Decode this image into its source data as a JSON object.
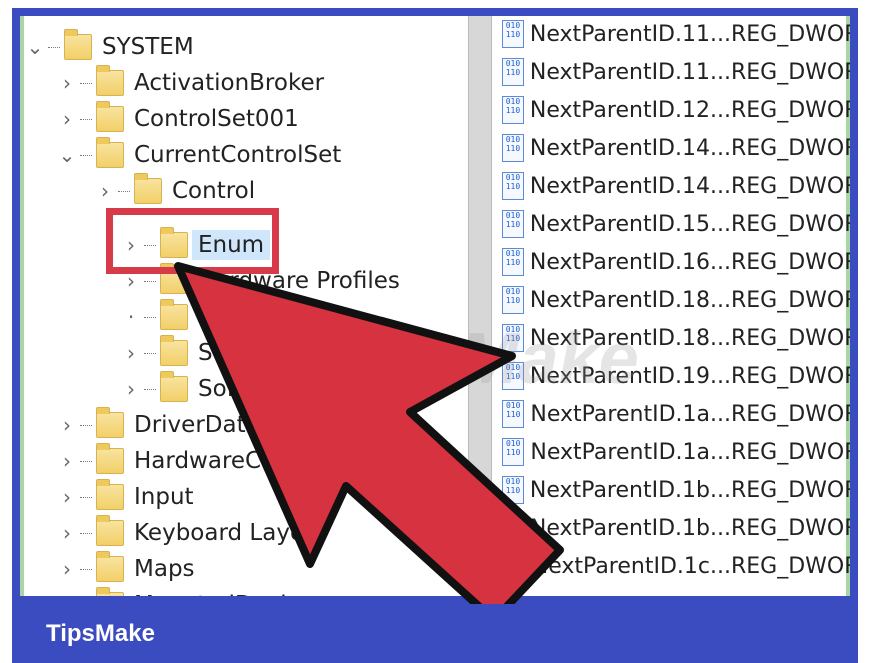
{
  "tree": {
    "items": [
      {
        "label": "SYSTEM",
        "expanded": true
      },
      {
        "label": "ActivationBroker",
        "expanded": false
      },
      {
        "label": "ControlSet001",
        "expanded": false
      },
      {
        "label": "CurrentControlSet",
        "expanded": true
      },
      {
        "label": "Control",
        "expanded": false
      },
      {
        "label": "Enum",
        "expanded": false,
        "selected": true
      },
      {
        "label": "Hardware Profiles",
        "expanded": false
      },
      {
        "label": "P",
        "expanded": false
      },
      {
        "label": "Ser",
        "expanded": false
      },
      {
        "label": "Softv",
        "expanded": false
      },
      {
        "label": "DriverData",
        "expanded": false
      },
      {
        "label": "HardwareCo",
        "expanded": false
      },
      {
        "label": "Input",
        "expanded": false
      },
      {
        "label": "Keyboard Layo",
        "expanded": false
      },
      {
        "label": "Maps",
        "expanded": false
      },
      {
        "label": "MountedDevices",
        "expanded": false
      }
    ]
  },
  "values": {
    "rows": [
      {
        "name": "NextParentID.11...",
        "type": "REG_DWORI"
      },
      {
        "name": "NextParentID.11...",
        "type": "REG_DWORI"
      },
      {
        "name": "NextParentID.12...",
        "type": "REG_DWORI"
      },
      {
        "name": "NextParentID.14...",
        "type": "REG_DWORI"
      },
      {
        "name": "NextParentID.14...",
        "type": "REG_DWORI"
      },
      {
        "name": "NextParentID.15...",
        "type": "REG_DWORI"
      },
      {
        "name": "NextParentID.16...",
        "type": "REG_DWORI"
      },
      {
        "name": "NextParentID.18...",
        "type": "REG_DWORI"
      },
      {
        "name": "NextParentID.18...",
        "type": "REG_DWORI"
      },
      {
        "name": "NextParentID.19...",
        "type": "REG_DWORI"
      },
      {
        "name": "NextParentID.1a...",
        "type": "REG_DWORI"
      },
      {
        "name": "NextParentID.1a...",
        "type": "REG_DWORI"
      },
      {
        "name": "NextParentID.1b...",
        "type": "REG_DWORI"
      },
      {
        "name": "NextParentID.1b...",
        "type": "REG_DWORI"
      },
      {
        "name": "NextParentID.1c...",
        "type": "REG_DWORI"
      }
    ]
  },
  "overlay": {
    "watermark": "TipsMake",
    "arrow_color": "#d7323f"
  },
  "footer": {
    "brand": "TipsMake"
  },
  "colors": {
    "frame": "#3b4cc0",
    "highlight": "#d73b4a",
    "selection": "#cfe6fb"
  }
}
